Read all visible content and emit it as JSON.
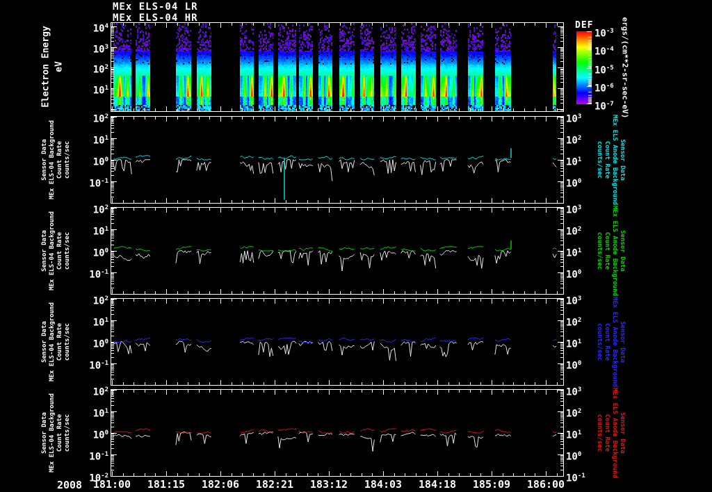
{
  "ui": {
    "titles": [
      "MEx ELS-04 LR",
      "MEx ELS-04 HR"
    ],
    "year_label": "2008",
    "x_tick_labels": [
      "181:00",
      "181:15",
      "182:06",
      "182:21",
      "183:12",
      "184:03",
      "184:18",
      "185:09",
      "186:00"
    ],
    "colors": {
      "background": "#000000",
      "frame": "#ffffff",
      "white_trace": "#e8e8e8",
      "cyan": "#00e6e6",
      "green": "#00d800",
      "blue": "#2a2aff",
      "red": "#e41414"
    },
    "spectrogram": {
      "ylabel_lines": [
        "Electron Energy",
        "eV"
      ],
      "y_tick_exps": [
        4,
        3,
        2,
        1
      ],
      "colorbar": {
        "title": "DEF",
        "tick_exps": [
          -3,
          -4,
          -5,
          -6,
          -7
        ],
        "unit_label": "ergs/(cm**2-sr-sec-eV)"
      }
    },
    "line_panels": [
      {
        "color_key": "cyan",
        "left_label_lines": [
          "Sensor Data",
          "MEx ELS-04 Background",
          "Count Rate",
          "counts/sec"
        ],
        "right_label_lines": [
          "Sensor Data",
          "MEx ELS Anode Background",
          "Count Rate",
          "counts/sec"
        ],
        "left_tick_exps": [
          2,
          1,
          0,
          -1
        ],
        "right_tick_exps": [
          3,
          2,
          1,
          0
        ]
      },
      {
        "color_key": "green",
        "left_label_lines": [
          "Sensor Data",
          "MEx ELS-04 Background",
          "Count Rate",
          "counts/sec"
        ],
        "right_label_lines": [
          "Sensor Data",
          "MEx ELS Anode Background",
          "Count Rate",
          "counts/sec"
        ],
        "left_tick_exps": [
          2,
          1,
          0,
          -1
        ],
        "right_tick_exps": [
          3,
          2,
          1,
          0
        ]
      },
      {
        "color_key": "blue",
        "left_label_lines": [
          "Sensor Data",
          "MEx ELS-04 Background",
          "Count Rate",
          "counts/sec"
        ],
        "right_label_lines": [
          "Sensor Data",
          "MEx ELS Anode Background",
          "Count Rate",
          "counts/sec"
        ],
        "left_tick_exps": [
          2,
          1,
          0,
          -1
        ],
        "right_tick_exps": [
          3,
          2,
          1,
          0
        ]
      },
      {
        "color_key": "red",
        "left_label_lines": [
          "Sensor Data",
          "MEx ELS-04 Background",
          "Count Rate",
          "counts/sec"
        ],
        "right_label_lines": [
          "Sensor Data",
          "MEx ELS Anode Background",
          "Count Rate",
          "counts/sec"
        ],
        "left_tick_exps": [
          2,
          1,
          0,
          -1,
          -2
        ],
        "right_tick_exps": [
          3,
          2,
          1,
          0,
          -1
        ]
      }
    ]
  },
  "chart_data": [
    {
      "type": "heatmap",
      "panel": "electron-energy-time-spectrogram",
      "title_lines": [
        "MEx ELS-04 LR",
        "MEx ELS-04 HR"
      ],
      "x_year": "2008",
      "x_time_ticks": [
        "181:00",
        "181:15",
        "182:06",
        "182:21",
        "183:12",
        "184:03",
        "184:18",
        "185:09",
        "186:00"
      ],
      "y_axis": {
        "label": "Electron Energy (eV)",
        "scale": "log",
        "range": [
          1,
          20000
        ],
        "tick_exps": [
          4,
          3,
          2,
          1
        ]
      },
      "color_axis": {
        "label": "DEF",
        "units": "ergs/(cm**2-sr-sec-eV)",
        "scale": "log",
        "range_exps": [
          -7,
          -3
        ]
      },
      "segments_frac": {
        "starts": [
          0.005,
          0.054,
          0.143,
          0.189,
          0.285,
          0.326,
          0.369,
          0.415,
          0.458,
          0.504,
          0.551,
          0.595,
          0.641,
          0.684,
          0.727,
          0.789,
          0.849,
          0.977
        ],
        "widths": [
          0.04,
          0.032,
          0.034,
          0.032,
          0.03,
          0.032,
          0.04,
          0.031,
          0.031,
          0.034,
          0.031,
          0.035,
          0.032,
          0.034,
          0.037,
          0.034,
          0.035,
          0.008
        ]
      },
      "features": "telemetry gaps between stripes; sparse violet flux above ~500 eV; bright green-yellow flux 5-100 eV near 1e-4 ergs"
    },
    {
      "type": "line",
      "panel": "background-count-rate-anode-cyan",
      "color_key": "cyan",
      "y_scale": "log",
      "left_range": [
        0.01,
        100
      ],
      "right_range": [
        0.1,
        1000
      ],
      "anode_baseline_counts_right_scale": 12,
      "els04_baseline_counts_left_scale": 0.72,
      "anode_trace_level": 1.2,
      "white_trace_level": 0.72,
      "jitter_dex": 0.18,
      "dip_prob": 0.18,
      "spikes": [
        {
          "segment": 6,
          "frac": 0.35,
          "to": 0.014
        },
        {
          "segment": 16,
          "frac": 1.0,
          "to": 3.5
        }
      ]
    },
    {
      "type": "line",
      "panel": "background-count-rate-anode-green",
      "color_key": "green",
      "y_scale": "log",
      "left_range": [
        0.01,
        100
      ],
      "right_range": [
        0.1,
        1000
      ],
      "anode_baseline_counts_right_scale": 12,
      "els04_baseline_counts_left_scale": 0.72,
      "anode_trace_level": 1.2,
      "white_trace_level": 0.72,
      "jitter_dex": 0.18,
      "dip_prob": 0.16,
      "spikes": [
        {
          "segment": 16,
          "frac": 1.0,
          "to": 3.0
        }
      ]
    },
    {
      "type": "line",
      "panel": "background-count-rate-anode-blue",
      "color_key": "blue",
      "y_scale": "log",
      "left_range": [
        0.01,
        100
      ],
      "right_range": [
        0.1,
        1000
      ],
      "anode_baseline_counts_right_scale": 11,
      "els04_baseline_counts_left_scale": 0.75,
      "anode_trace_level": 1.15,
      "white_trace_level": 0.75,
      "jitter_dex": 0.16,
      "dip_prob": 0.14,
      "spikes": []
    },
    {
      "type": "line",
      "panel": "background-count-rate-anode-red",
      "color_key": "red",
      "y_scale": "log",
      "left_range": [
        0.01,
        100
      ],
      "right_range": [
        0.1,
        1000
      ],
      "anode_baseline_counts_right_scale": 12,
      "els04_baseline_counts_left_scale": 0.78,
      "anode_trace_level": 1.18,
      "white_trace_level": 0.78,
      "jitter_dex": 0.1,
      "dip_prob": 0.06,
      "spikes": []
    }
  ]
}
